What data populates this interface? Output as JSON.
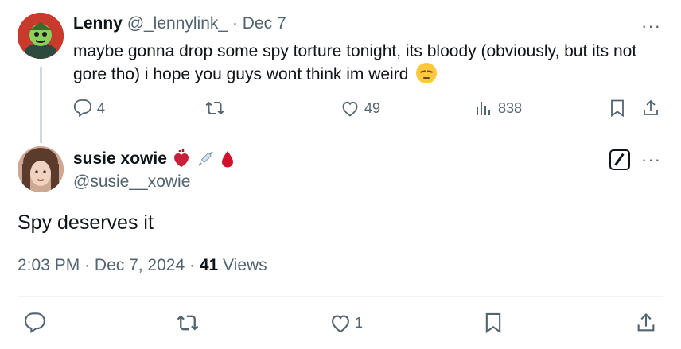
{
  "parent_tweet": {
    "display_name": "Lenny",
    "handle": "@_lennylink_",
    "separator": "·",
    "date": "Dec 7",
    "text": "maybe gonna drop some spy torture tonight, its bloody (obviously, but its not gore tho) i hope you guys wont think im weird",
    "emoji": "pensive-face",
    "more_label": "···",
    "actions": {
      "replies": "4",
      "reposts": "",
      "likes": "49",
      "views": "838"
    }
  },
  "reply_tweet": {
    "display_name": "susie xowie",
    "name_emojis": [
      "anatomical-heart",
      "syringe",
      "drop-of-blood"
    ],
    "handle": "@susie__xowie",
    "more_label": "···",
    "text": "Spy deserves it",
    "time": "2:03 PM",
    "date": "Dec 7, 2024",
    "views_count": "41",
    "views_label": "Views",
    "separator": "·",
    "actions": {
      "likes": "1"
    }
  },
  "colors": {
    "text": "#0f1419",
    "secondary": "#536471",
    "thread_line": "#cfd9de",
    "divider": "#eff3f4"
  }
}
